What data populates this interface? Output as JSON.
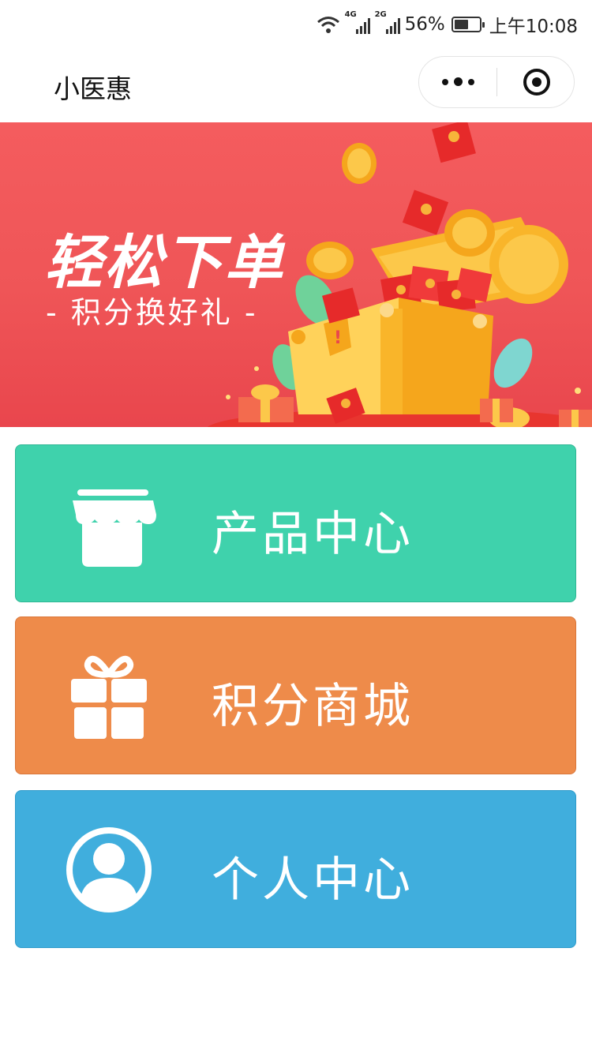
{
  "status_bar": {
    "net1": "4G",
    "net2": "2G",
    "battery_text": "56%",
    "battery_level": 0.56,
    "time": "上午10:08"
  },
  "titlebar": {
    "title": "小医惠"
  },
  "banner": {
    "title": "轻松下单",
    "subtitle": "- 积分换好礼 -"
  },
  "menu": [
    {
      "label": "产品中心",
      "icon": "store-icon",
      "color": "#3fd2ac"
    },
    {
      "label": "积分商城",
      "icon": "gift-icon",
      "color": "#ee8b4a"
    },
    {
      "label": "个人中心",
      "icon": "user-circle-icon",
      "color": "#40aedd"
    }
  ]
}
